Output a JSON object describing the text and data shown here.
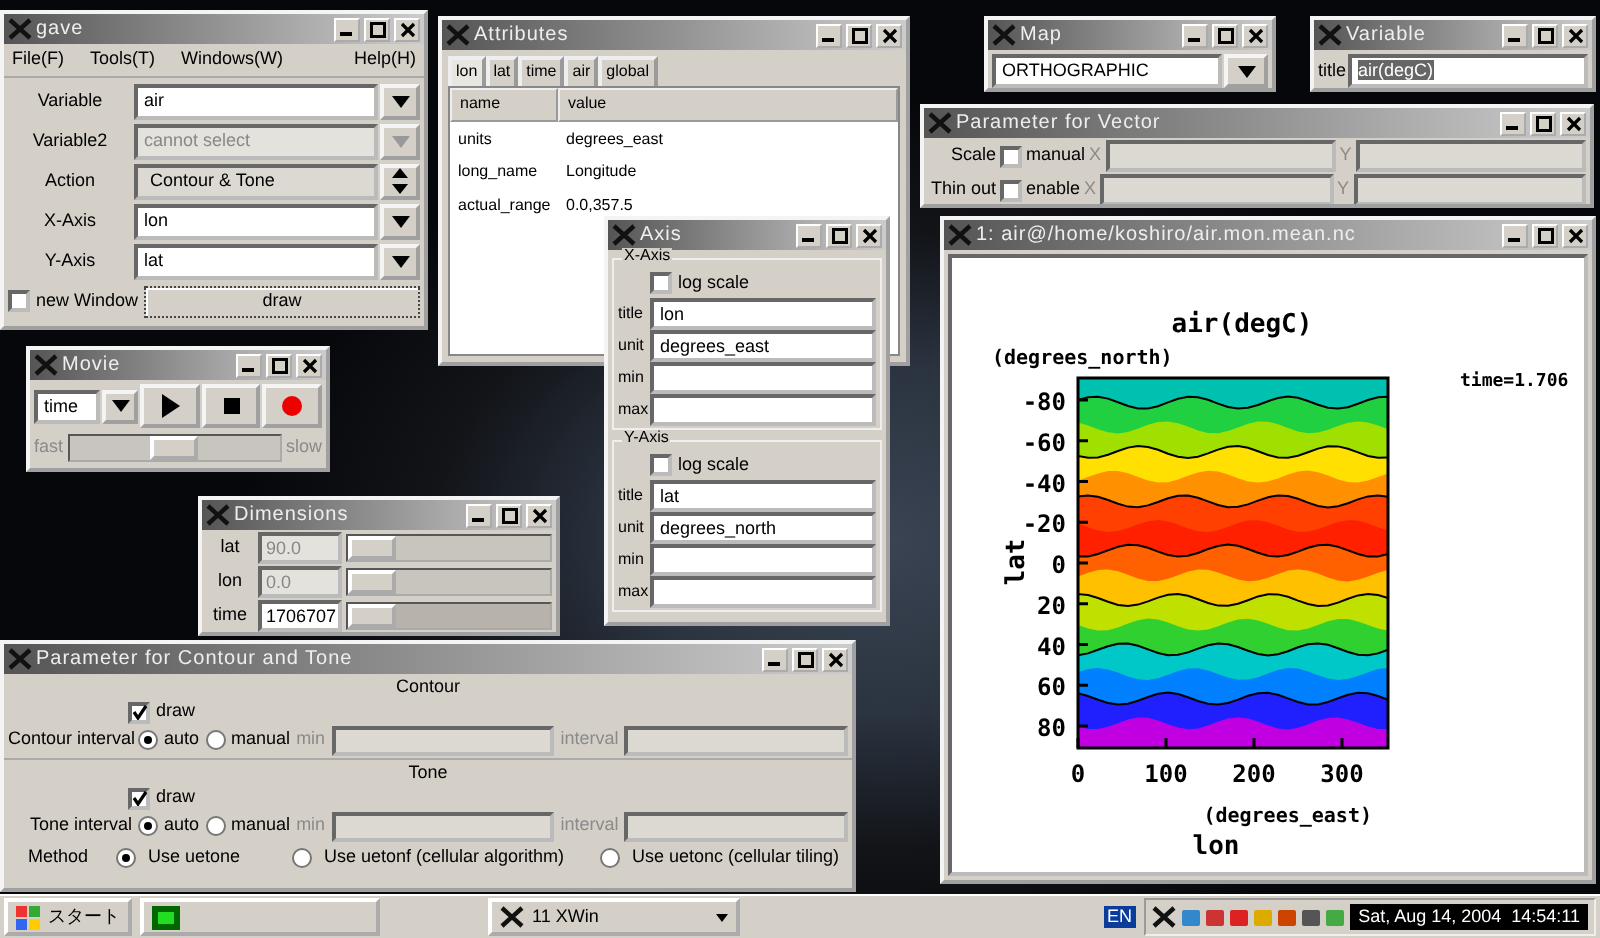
{
  "main_window": {
    "title": "gave",
    "menu": [
      "File(F)",
      "Tools(T)",
      "Windows(W)",
      "Help(H)"
    ],
    "fields": [
      {
        "label": "Variable",
        "value": "air",
        "kind": "combo",
        "disabled": false
      },
      {
        "label": "Variable2",
        "value": "cannot select",
        "kind": "combo",
        "disabled": true
      },
      {
        "label": "Action",
        "value": "Contour & Tone",
        "kind": "spin",
        "disabled": false
      },
      {
        "label": "X-Axis",
        "value": "lon",
        "kind": "combo",
        "disabled": false
      },
      {
        "label": "Y-Axis",
        "value": "lat",
        "kind": "combo",
        "disabled": false
      }
    ],
    "new_window": {
      "label": "new Window",
      "checked": false
    },
    "draw_button": "draw"
  },
  "attributes_window": {
    "title": "Attributes",
    "tabs": [
      {
        "label": "lon",
        "selected": true
      },
      {
        "label": "lat",
        "selected": false
      },
      {
        "label": "time",
        "selected": false
      },
      {
        "label": "air",
        "selected": false
      },
      {
        "label": "global",
        "selected": false
      }
    ],
    "columns": [
      "name",
      "value"
    ],
    "rows": [
      [
        "units",
        "degrees_east"
      ],
      [
        "long_name",
        "Longitude"
      ],
      [
        "actual_range",
        "0.0,357.5"
      ]
    ]
  },
  "map_window": {
    "title": "Map",
    "value": "ORTHOGRAPHIC"
  },
  "variable_window": {
    "title": "Variable",
    "label": "title",
    "value": "air(degC)"
  },
  "vector_window": {
    "title": "Parameter for Vector",
    "rows": [
      {
        "label": "Scale",
        "option": "manual",
        "checked": false,
        "x_label": "X",
        "y_label": "Y"
      },
      {
        "label": "Thin out",
        "option": "enable",
        "checked": false,
        "x_label": "X",
        "y_label": "Y"
      }
    ]
  },
  "movie_window": {
    "title": "Movie",
    "dimension": "time",
    "fast_label": "fast",
    "slow_label": "slow",
    "level": 0.5
  },
  "dimensions_window": {
    "title": "Dimensions",
    "rows": [
      {
        "label": "lat",
        "value": "90.0",
        "disabled": true,
        "level": 0
      },
      {
        "label": "lon",
        "value": "0.0",
        "disabled": true,
        "level": 0
      },
      {
        "label": "time",
        "value": "1706707",
        "disabled": false,
        "level": 0
      }
    ]
  },
  "axis_window": {
    "title": "Axis",
    "groups": [
      {
        "legend": "X-Axis",
        "log_scale": {
          "label": "log scale",
          "checked": false
        },
        "fields": [
          {
            "label": "title",
            "value": "lon"
          },
          {
            "label": "unit",
            "value": "degrees_east"
          },
          {
            "label": "min"
          },
          {
            "label": "max"
          }
        ]
      },
      {
        "legend": "Y-Axis",
        "log_scale": {
          "label": "log scale",
          "checked": false
        },
        "fields": [
          {
            "label": "title",
            "value": "lat"
          },
          {
            "label": "unit",
            "value": "degrees_north"
          },
          {
            "label": "min"
          },
          {
            "label": "max"
          }
        ]
      }
    ]
  },
  "plot_window": {
    "title": "1: air@/home/koshiro/air.mon.mean.nc",
    "plot_title": "air(degC)",
    "y_unit": "(degrees_north)",
    "x_unit": "(degrees_east)",
    "ylabel": "lat",
    "xlabel": "lon",
    "time_note": "time=1.706",
    "yticks": [
      "-80",
      "-60",
      "-40",
      "-20",
      "0",
      "20",
      "40",
      "60",
      "80"
    ],
    "xticks": [
      "0",
      "100",
      "200",
      "300"
    ]
  },
  "contour_window": {
    "title": "Parameter for Contour and Tone",
    "sections": [
      {
        "heading": "Contour",
        "draw": {
          "label": "draw",
          "checked": true
        },
        "interval_label": "Contour interval",
        "options": [
          {
            "label": "auto",
            "selected": true
          },
          {
            "label": "manual",
            "selected": false
          }
        ],
        "min_label": "min",
        "step_label": "interval"
      },
      {
        "heading": "Tone",
        "draw": {
          "label": "draw",
          "checked": true
        },
        "interval_label": "Tone interval",
        "options": [
          {
            "label": "auto",
            "selected": true
          },
          {
            "label": "manual",
            "selected": false
          }
        ],
        "min_label": "min",
        "step_label": "interval"
      }
    ],
    "method": {
      "label": "Method",
      "options": [
        {
          "label": "Use uetone",
          "selected": true
        },
        {
          "label": "Use uetonf (cellular algorithm)",
          "selected": false
        },
        {
          "label": "Use uetonc (cellular tiling)",
          "selected": false
        }
      ]
    }
  },
  "taskbar": {
    "start": "スタート",
    "tasks": [
      {
        "kind": "terminal"
      },
      {
        "kind": "xwin",
        "label": "11 XWin"
      }
    ],
    "language": "EN",
    "clock": "Sat, Aug 14, 2004  14:54:11"
  }
}
